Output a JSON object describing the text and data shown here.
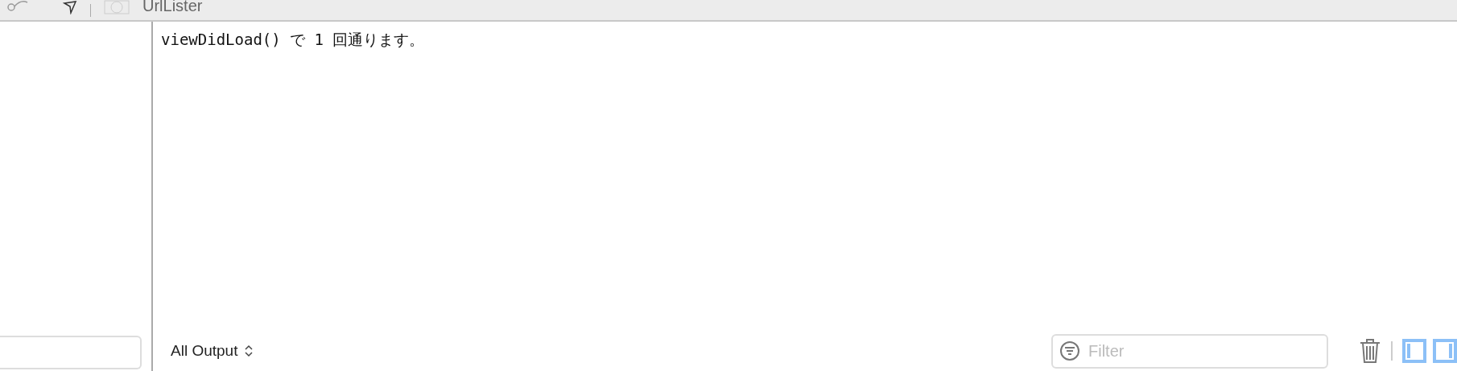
{
  "toolbar": {
    "title": "UrlLister"
  },
  "console": {
    "lines": [
      "viewDidLoad() で 1 回通ります。"
    ]
  },
  "bottom_bar": {
    "output_selector": "All Output",
    "filter": {
      "placeholder": "Filter"
    },
    "panel_toggles": [
      {
        "kind": "left",
        "selected": true
      },
      {
        "kind": "right",
        "selected": true
      }
    ]
  }
}
